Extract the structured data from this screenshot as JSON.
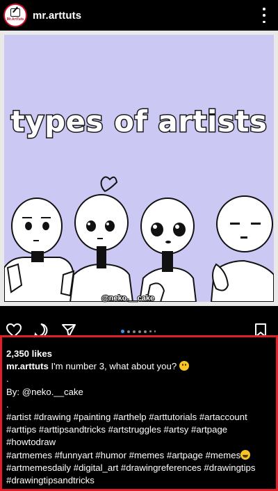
{
  "header": {
    "username": "mr.arttuts",
    "avatar_text": "Mr.ArtTuts"
  },
  "post": {
    "title": "types of artists",
    "watermark": "@neko.__cake",
    "bg_color": "#cbc8f4"
  },
  "carousel": {
    "count": 7,
    "active_index": 0
  },
  "icons": [
    "heart-icon",
    "comment-icon",
    "share-icon",
    "bookmark-icon",
    "more-icon"
  ],
  "caption": {
    "likes": "2,350 likes",
    "author": "mr.arttuts",
    "text": "I'm number 3, what about you?",
    "dot1": ".",
    "credit": "By: @neko.__cake",
    "dot2": ".",
    "hashtags_1a": " #artist #drawing #painting #arthelp #arttutorials #artaccount",
    "hashtags_1b": "#arttips #arttipsandtricks #artstruggles #artsy #artpage",
    "hashtags_1c": "#howtodraw",
    "hashtags_2a": " #artmemes #funnyart #humor #memes #artpage #memes",
    "hashtags_2b": "#artmemesdaily #digital_art #drawingreferences #drawingtips",
    "hashtags_2c": "#drawingtipsandtricks"
  },
  "colors": {
    "highlight_border": "#e11d2a",
    "carousel_active": "#3897f0"
  }
}
